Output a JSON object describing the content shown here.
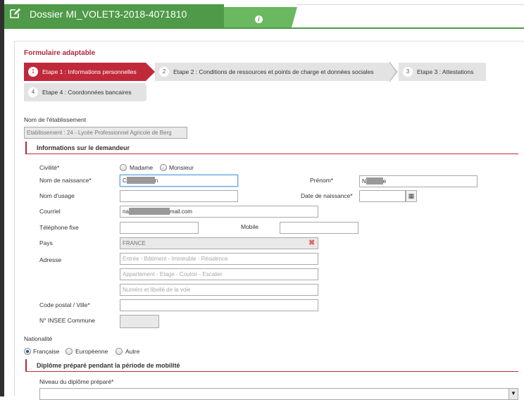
{
  "window": {
    "title": "Dossier MI_VOLET3-2018-4071810",
    "title_icon": "edit-icon",
    "info_icon": "info-icon",
    "info_glyph": "i"
  },
  "form": {
    "title": "Formulaire adaptable",
    "steps": [
      {
        "num": "1",
        "label": "Etape 1 : Informations personnelles",
        "active": true
      },
      {
        "num": "2",
        "label": "Etape 2 : Conditions de ressources et points de charge et données sociales",
        "active": false
      },
      {
        "num": "3",
        "label": "Etape 3 : Attestations",
        "active": false
      },
      {
        "num": "4",
        "label": "Etape 4 : Coordonnées bancaires",
        "active": false
      }
    ]
  },
  "etablissement": {
    "label": "Nom de l'établissement",
    "value": "Etablissement : 24 - Lycée Professionnel Agricole de Berg"
  },
  "demandeur": {
    "heading": "Informations sur le demandeur",
    "civilite_label": "Civilité*",
    "civilite_options": [
      "Madame",
      "Monsieur"
    ],
    "nom_naissance_label": "Nom de naissance*",
    "nom_naissance_value_start": "C",
    "nom_naissance_value_end": "n",
    "prenom_label": "Prénom*",
    "prenom_value_start": "N",
    "prenom_value_end": "e",
    "nom_usage_label": "Nom d'usage",
    "date_naissance_label": "Date de naissance*",
    "calendar_icon": "calendar-icon",
    "calendar_glyph": "▦",
    "courriel_label": "Courriel",
    "courriel_value_start": "na",
    "courriel_value_end": "mail.com",
    "tel_fixe_label": "Téléphone fixe",
    "mobile_label": "Mobile",
    "pays_label": "Pays",
    "pays_value": "FRANCE",
    "clear_glyph": "✖",
    "adresse_label": "Adresse",
    "adresse_ph1": "Entrée - Bâtiment - Immeuble - Résidence",
    "adresse_ph2": "Appartement - Etage - Couloir - Escalier",
    "adresse_ph3": "Numéro et libellé de la voie",
    "cp_ville_label": "Code postal / Ville*",
    "insee_label": "N° INSEE Commune"
  },
  "nationalite": {
    "label": "Nationalité",
    "options": [
      "Française",
      "Européenne",
      "Autre"
    ],
    "selected": "Française"
  },
  "diplome": {
    "heading": "Diplôme préparé pendant la période de mobilité",
    "niveau_label": "Niveau du diplôme préparé*",
    "arrow_glyph": "▼"
  },
  "colors": {
    "header_green": "#4f9a48",
    "accent_red": "#c0293a",
    "step_grey": "#e3e3e3"
  }
}
